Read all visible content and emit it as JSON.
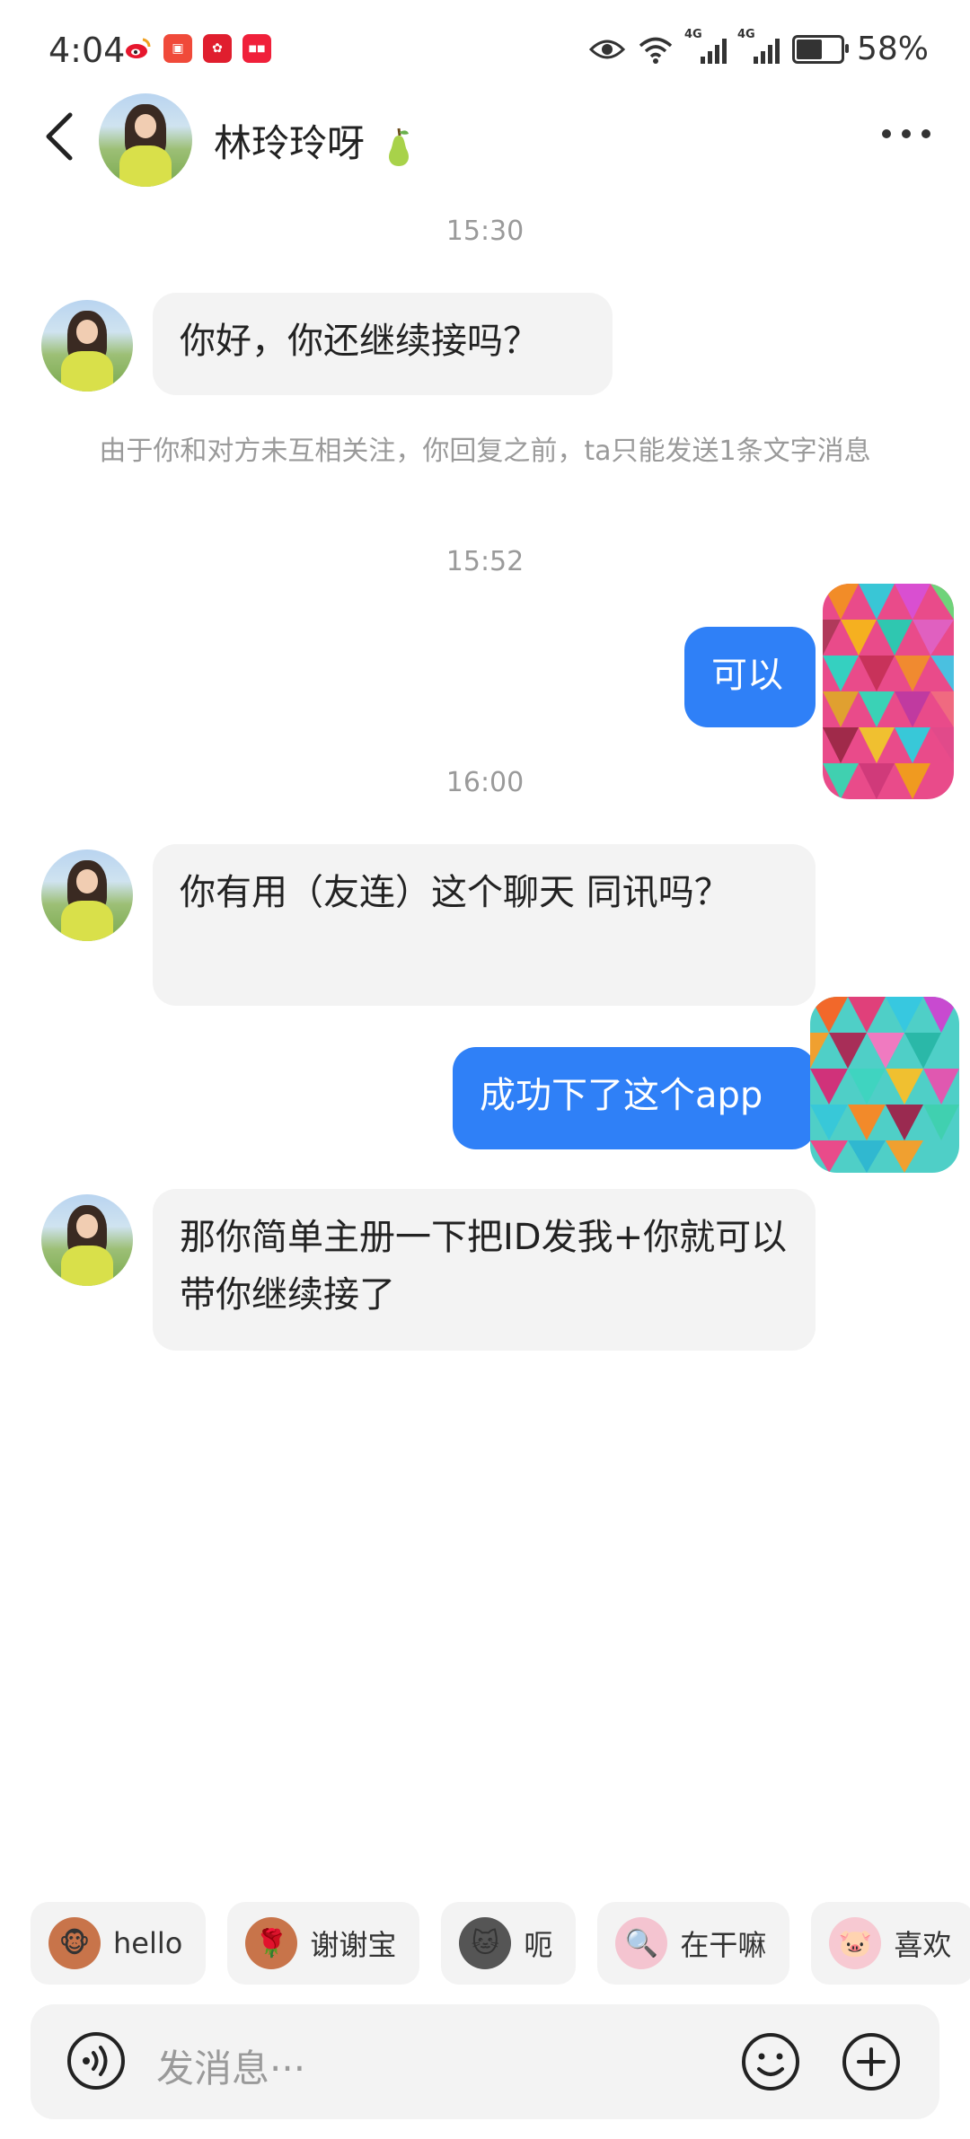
{
  "status_bar": {
    "time": "4:04",
    "battery": "58%",
    "network_1": "4G",
    "network_2": "4G",
    "app_icons": [
      "weibo-icon",
      "app-icon-red",
      "app-icon-red-2",
      "app-icon-red-3"
    ]
  },
  "header": {
    "name": "林玲玲呀",
    "name_emoji": "pear-icon"
  },
  "timestamps": [
    "15:30",
    "15:52",
    "16:00"
  ],
  "notice": "由于你和对方未互相关注，你回复之前，ta只能发送1条文字消息",
  "messages": [
    {
      "side": "in",
      "text": "你好，你还继续接吗？"
    },
    {
      "side": "out",
      "text": "可以"
    },
    {
      "side": "in",
      "text": "你有用（友连）这个聊天 同讯吗？"
    },
    {
      "side": "out",
      "text": "成功下了这个app"
    },
    {
      "side": "in",
      "text": "那你简单主册一下把ID发我+你就可以带你继续接了"
    }
  ],
  "quick_replies": [
    {
      "label": "hello",
      "icon": "monkey-icon"
    },
    {
      "label": "谢谢宝",
      "icon": "monkey-flower-icon"
    },
    {
      "label": "呃",
      "icon": "cat-icon"
    },
    {
      "label": "在干嘛",
      "icon": "magnifier-icon"
    },
    {
      "label": "喜欢",
      "icon": "pig-icon"
    }
  ],
  "input": {
    "placeholder": "发消息···"
  },
  "colors": {
    "outgoing_bubble": "#2f80f7",
    "incoming_bubble": "#f3f3f3",
    "meta_text": "#9a9a9a"
  }
}
